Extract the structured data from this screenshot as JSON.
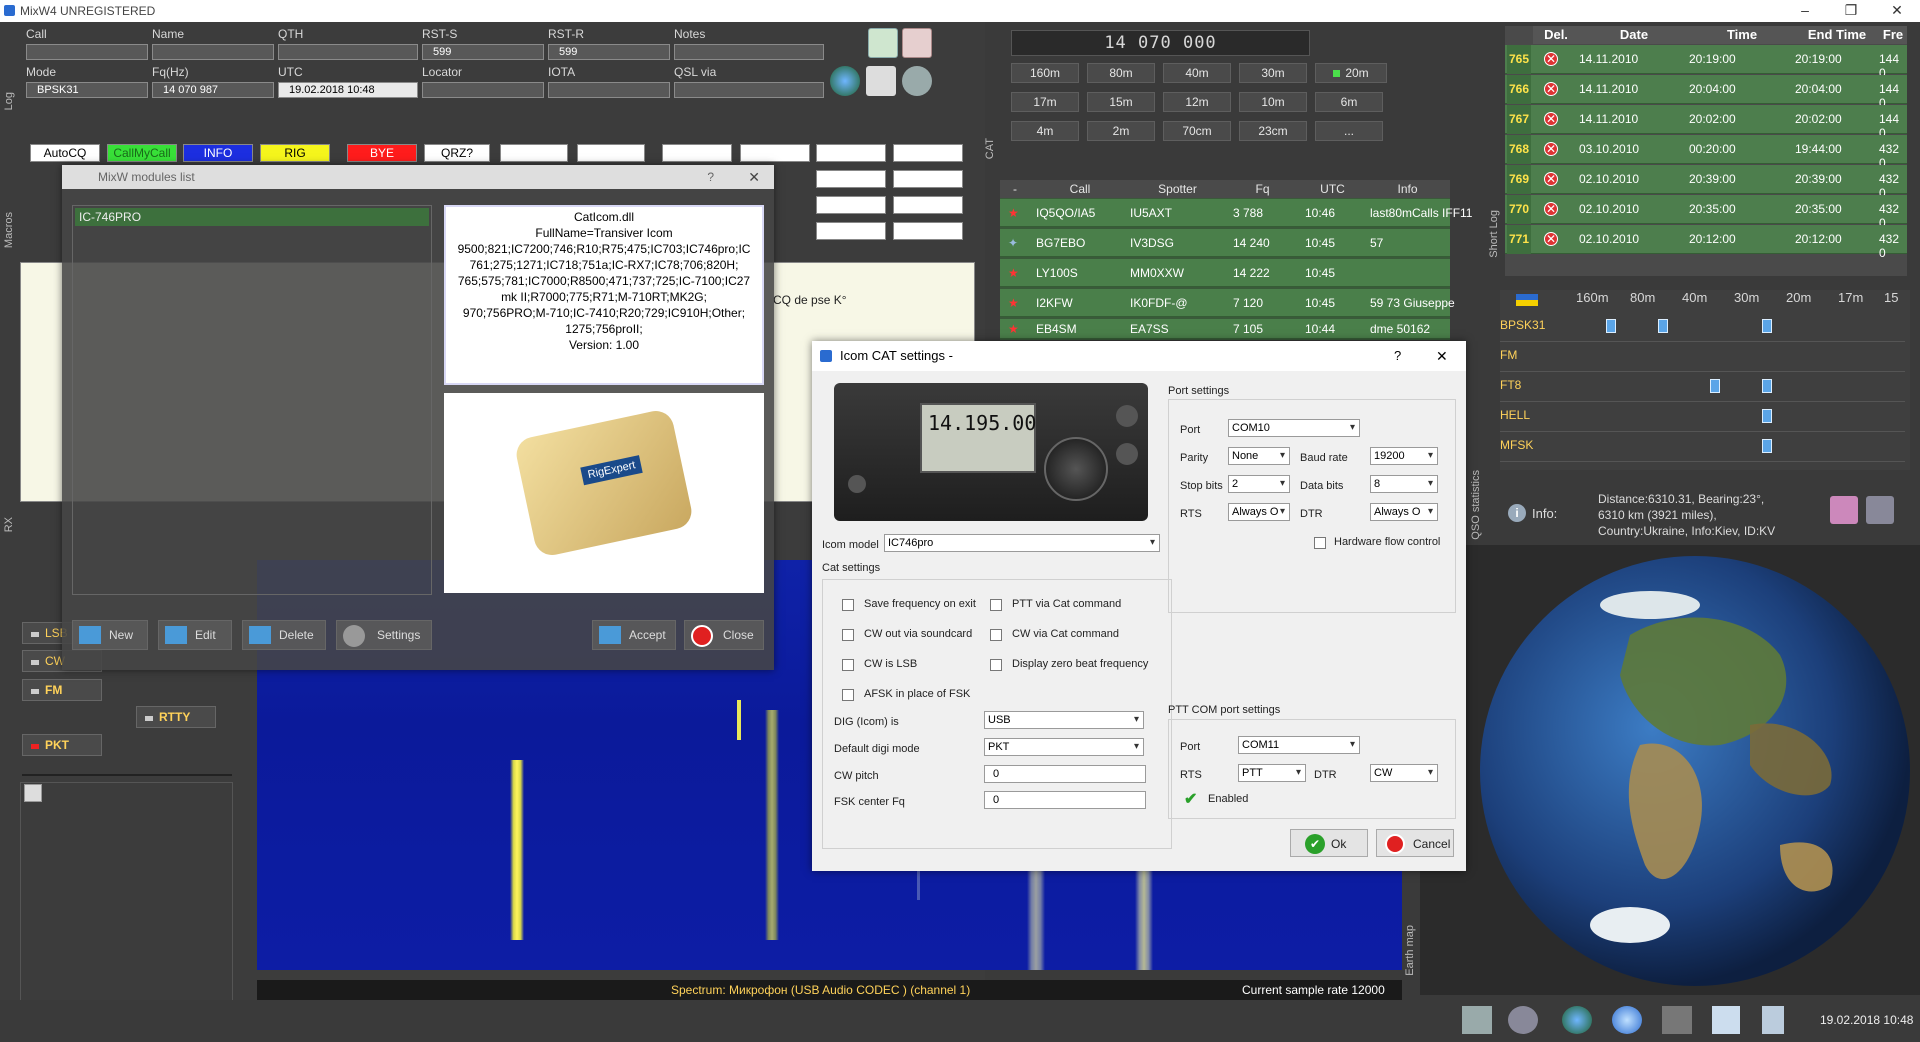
{
  "window": {
    "title": "MixW4  UNREGISTERED"
  },
  "qso": {
    "labels": {
      "call": "Call",
      "name": "Name",
      "qth": "QTH",
      "rsts": "RST-S",
      "rstr": "RST-R",
      "notes": "Notes",
      "mode": "Mode",
      "fq": "Fq(Hz)",
      "utc": "UTC",
      "locator": "Locator",
      "iota": "IOTA",
      "qslvia": "QSL via"
    },
    "values": {
      "call": "",
      "name": "",
      "qth": "",
      "rsts": "599",
      "rstr": "599",
      "notes": "",
      "mode": "BPSK31",
      "fq": "14 070 987",
      "utc": "19.02.2018 10:48",
      "locator": "",
      "iota": "",
      "qslvia": ""
    }
  },
  "side_tabs": {
    "log": "Log",
    "macros": "Macros",
    "rx": "RX",
    "cat": "CAT",
    "short_log": "Short Log",
    "qso_stats": "QSO statistics",
    "earth_map": "Earth map"
  },
  "macros": {
    "row1": [
      "AutoCQ",
      "CallMyCall",
      "INFO",
      "RIG",
      "BYE",
      "QRZ?"
    ]
  },
  "rx_text": [
    "CQ de pse K°"
  ],
  "modes": [
    "LSB",
    "CW",
    "FM",
    "PKT",
    "RTTY"
  ],
  "cat": {
    "frequency": "14 070 000",
    "bands": [
      "160m",
      "80m",
      "40m",
      "30m",
      "20m",
      "17m",
      "15m",
      "12m",
      "10m",
      "6m",
      "4m",
      "2m",
      "70cm",
      "23cm",
      "..."
    ],
    "active_band": "20m"
  },
  "spots": {
    "headers": [
      "-",
      "Call",
      "Spotter",
      "Fq",
      "UTC",
      "Info"
    ],
    "rows": [
      {
        "call": "IQ5QO/IA5",
        "spotter": "IU5AXT",
        "fq": "3 788",
        "utc": "10:46",
        "info": "last80mCalls IFF11"
      },
      {
        "call": "BG7EBO",
        "spotter": "IV3DSG",
        "fq": "14 240",
        "utc": "10:45",
        "info": "57"
      },
      {
        "call": "LY100S",
        "spotter": "MM0XXW",
        "fq": "14 222",
        "utc": "10:45",
        "info": ""
      },
      {
        "call": "I2KFW",
        "spotter": "IK0FDF-@",
        "fq": "7 120",
        "utc": "10:45",
        "info": "59 73 Giuseppe"
      },
      {
        "call": "EB4SM",
        "spotter": "EA7SS",
        "fq": "7 105",
        "utc": "10:44",
        "info": "dme 50162"
      }
    ]
  },
  "log": {
    "headers": [
      "Del.",
      "Date",
      "Time",
      "End Time",
      "Fre"
    ],
    "rows": [
      {
        "num": "765",
        "date": "14.11.2010",
        "time": "20:19:00",
        "end": "20:19:00",
        "fq": "144 0"
      },
      {
        "num": "766",
        "date": "14.11.2010",
        "time": "20:04:00",
        "end": "20:04:00",
        "fq": "144 0"
      },
      {
        "num": "767",
        "date": "14.11.2010",
        "time": "20:02:00",
        "end": "20:02:00",
        "fq": "144 0"
      },
      {
        "num": "768",
        "date": "03.10.2010",
        "time": "00:20:00",
        "end": "19:44:00",
        "fq": "432 0"
      },
      {
        "num": "769",
        "date": "02.10.2010",
        "time": "20:39:00",
        "end": "20:39:00",
        "fq": "432 0"
      },
      {
        "num": "770",
        "date": "02.10.2010",
        "time": "20:35:00",
        "end": "20:35:00",
        "fq": "432 0"
      },
      {
        "num": "771",
        "date": "02.10.2010",
        "time": "20:12:00",
        "end": "20:12:00",
        "fq": "432 0"
      }
    ]
  },
  "stats": {
    "bands": [
      "160m",
      "80m",
      "40m",
      "30m",
      "20m",
      "17m",
      "15"
    ],
    "modes": [
      "BPSK31",
      "FM",
      "FT8",
      "HELL",
      "MFSK"
    ]
  },
  "info": {
    "label": "Info:",
    "line1": "Distance:6310.31, Bearing:23°,",
    "line2": "6310 km (3921 miles),",
    "line3": "Country:Ukraine, Info:Kiev, ID:KV"
  },
  "spectrum": {
    "caption": "Spectrum: Микрофон (USB Audio CODEC ) (channel 1)",
    "sample_rate": "Current sample rate 12000"
  },
  "taskbar": {
    "datetime": "19.02.2018 10:48"
  },
  "modules_dialog": {
    "title": "MixW modules list",
    "selected_item": "IC-746PRO",
    "detail_lines": [
      "CatIcom.dll",
      "FullName=Transiver Icom",
      "9500;821;IC7200;746;R10;R75;475;IC703;IC746pro;IC",
      "761;275;1271;IC718;751a;IC-RX7;IC78;706;820H;",
      "765;575;781;IC7000;R8500;471;737;725;IC-7100;IC27",
      "mk II;R7000;775;R71;M-710RT;MK2G;",
      "970;756PRO;M-710;IC-7410;R20;729;IC910H;Other;",
      "1275;756proII;",
      "Version: 1.00"
    ],
    "device_brand": "RigExpert",
    "buttons": {
      "new": "New",
      "edit": "Edit",
      "delete": "Delete",
      "settings": "Settings",
      "accept": "Accept",
      "close": "Close"
    }
  },
  "cat_dialog": {
    "title": "Icom CAT settings -",
    "help": "?",
    "close": "✕",
    "radio_display": "14.195.00",
    "icom_model_label": "Icom model",
    "icom_model": "IC746pro",
    "cat_settings_label": "Cat settings",
    "checks": [
      {
        "label": "Save frequency on exit",
        "checked": false
      },
      {
        "label": "PTT via Cat command",
        "checked": false
      },
      {
        "label": "CW out via soundcard",
        "checked": false
      },
      {
        "label": "CW via Cat command",
        "checked": false
      },
      {
        "label": "CW is LSB",
        "checked": false
      },
      {
        "label": "Display zero beat frequency",
        "checked": false
      },
      {
        "label": "AFSK in place of FSK",
        "checked": false
      }
    ],
    "dig_label": "DIG (Icom) is",
    "dig": "USB",
    "digimode_label": "Default digi mode",
    "digimode": "PKT",
    "cwpitch_label": "CW pitch",
    "cwpitch": "0",
    "fsk_label": "FSK center Fq",
    "fsk": "0",
    "port_settings_label": "Port settings",
    "port_label": "Port",
    "port": "COM10",
    "parity_label": "Parity",
    "parity": "None",
    "baud_label": "Baud rate",
    "baud": "19200",
    "stopbits_label": "Stop bits",
    "stopbits": "2",
    "databits_label": "Data bits",
    "databits": "8",
    "rts_label": "RTS",
    "rts": "Always O",
    "dtr_label": "DTR",
    "dtr": "Always O",
    "hwflow_label": "Hardware flow control",
    "ptt_label": "PTT COM port settings",
    "ptt_port_label": "Port",
    "ptt_port": "COM11",
    "ptt_rts_label": "RTS",
    "ptt_rts": "PTT",
    "ptt_dtr_label": "DTR",
    "ptt_dtr": "CW",
    "enabled_label": "Enabled",
    "ok": "Ok",
    "cancel": "Cancel"
  }
}
